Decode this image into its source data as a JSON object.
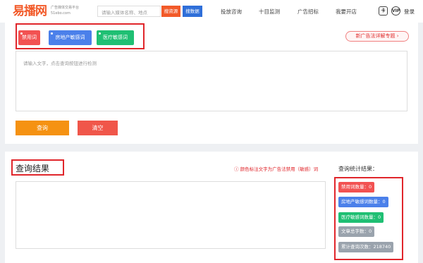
{
  "header": {
    "logo_text": "易播网",
    "logo_tagline": "广告媒体交易平台",
    "logo_domain": "51ebo.com",
    "search_placeholder": "请输入媒体名称、地点",
    "search_media_btn": "搜资源",
    "search_data_btn": "搜数据",
    "nav": [
      "投放咨询",
      "十目监测",
      "广告招标",
      "我要开店"
    ],
    "icon_one": "卡",
    "icon_vip": "VIP",
    "login": "登录"
  },
  "checker": {
    "tags": [
      "禁用词",
      "房地产敏感词",
      "医疗敏感词"
    ],
    "special_link": "新广告法详解专题 ›",
    "input_placeholder": "请输入文字，点击查询按钮进行检测",
    "query_btn": "查询",
    "clear_btn": "清空"
  },
  "results": {
    "title": "查询结果",
    "note": "ⓘ 颜色标注文字为广告法禁用（敏感）词",
    "stats_title": "查询统计结果：",
    "stats": [
      {
        "label": "禁用词数量：0",
        "color": "red"
      },
      {
        "label": "房地产敏感词数量：0",
        "color": "blue"
      },
      {
        "label": "医疗敏感词数量：0",
        "color": "green"
      },
      {
        "label": "文章总字数：0",
        "color": "gray"
      },
      {
        "label": "累计查询次数：218740",
        "color": "gray"
      }
    ]
  }
}
